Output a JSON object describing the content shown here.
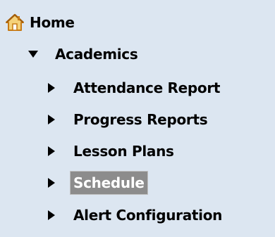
{
  "tree": {
    "home": {
      "label": "Home",
      "icon": "home-icon"
    },
    "academics": {
      "label": "Academics",
      "expanded": true,
      "children": [
        {
          "label": "Attendance Report"
        },
        {
          "label": "Progress Reports"
        },
        {
          "label": "Lesson Plans"
        },
        {
          "label": "Schedule",
          "selected": true
        },
        {
          "label": "Alert Configuration"
        }
      ]
    }
  },
  "colors": {
    "panel_background": "#dce6f1",
    "selected_background": "#8c8c8c",
    "selected_text": "#ffffff",
    "home_icon_roof": "#c77a14",
    "home_icon_body": "#f5d27a"
  }
}
